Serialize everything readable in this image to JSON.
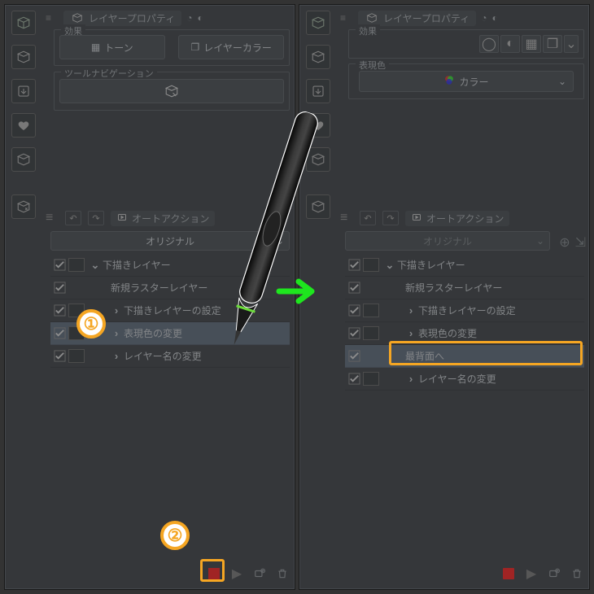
{
  "panels": {
    "left": {
      "prop_title": "レイヤープロパティ",
      "effect_legend": "効果",
      "effect_btn1": "トーン",
      "effect_btn2": "レイヤーカラー",
      "nav_legend": "ツールナビゲーション",
      "auto_title": "オートアクション",
      "set_selected": "オリジナル",
      "items": [
        {
          "label": "下描きレイヤー",
          "depth": 0,
          "tg": "v",
          "sw": true
        },
        {
          "label": "新規ラスターレイヤー",
          "depth": 1,
          "tg": "",
          "sw": false
        },
        {
          "label": "下描きレイヤーの設定",
          "depth": 1,
          "tg": ">",
          "sw": true
        },
        {
          "label": "表現色の変更",
          "depth": 1,
          "tg": ">",
          "sw": true,
          "sel": true
        },
        {
          "label": "レイヤー名の変更",
          "depth": 1,
          "tg": ">",
          "sw": true
        }
      ]
    },
    "right": {
      "prop_title": "レイヤープロパティ",
      "effect_legend": "効果",
      "expr_legend": "表現色",
      "color_label": "カラー",
      "auto_title": "オートアクション",
      "set_selected": "オリジナル",
      "items": [
        {
          "label": "下描きレイヤー",
          "depth": 0,
          "tg": "v",
          "sw": true
        },
        {
          "label": "新規ラスターレイヤー",
          "depth": 1,
          "tg": "",
          "sw": false
        },
        {
          "label": "下描きレイヤーの設定",
          "depth": 1,
          "tg": ">",
          "sw": true
        },
        {
          "label": "表現色の変更",
          "depth": 1,
          "tg": ">",
          "sw": true
        },
        {
          "label": "最背面へ",
          "depth": 1,
          "tg": "",
          "sw": false,
          "hl": true
        },
        {
          "label": "レイヤー名の変更",
          "depth": 1,
          "tg": ">",
          "sw": true
        }
      ]
    }
  },
  "annotations": {
    "n1": "①",
    "n2": "②"
  }
}
